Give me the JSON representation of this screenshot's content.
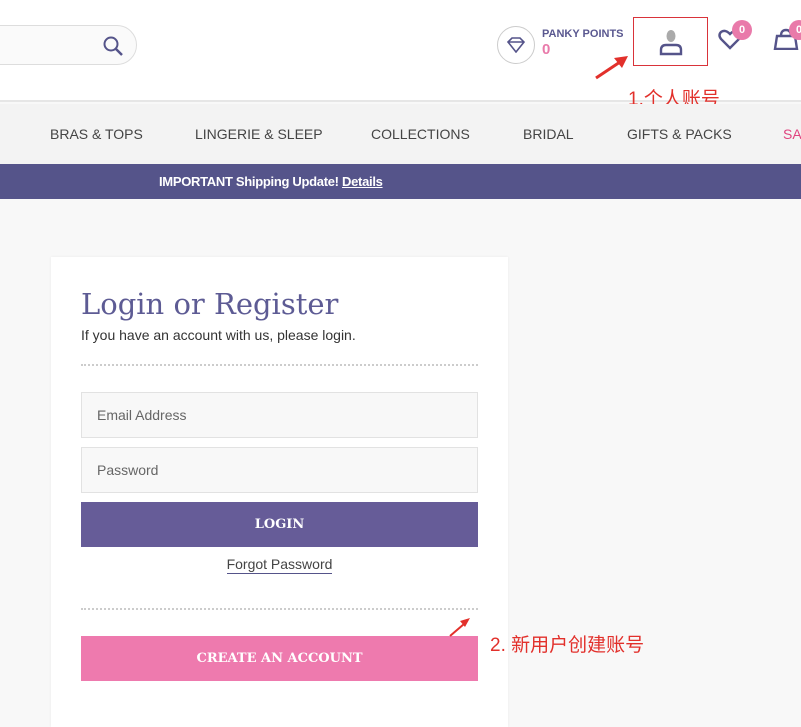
{
  "header": {
    "points_label": "PANKY POINTS",
    "points_value": "0",
    "wishlist_count": "0",
    "cart_count": "0"
  },
  "nav": {
    "items": [
      "BRAS & TOPS",
      "LINGERIE & SLEEP",
      "COLLECTIONS",
      "BRIDAL",
      "GIFTS & PACKS",
      "SA"
    ],
    "sale_color": "#e0447f"
  },
  "banner": {
    "text": "IMPORTANT Shipping Update!",
    "link": "Details"
  },
  "login": {
    "title": "Login or Register",
    "subtitle": "If you have an account with us, please login.",
    "email_placeholder": "Email Address",
    "password_placeholder": "Password",
    "login_button": "LOGIN",
    "forgot": "Forgot Password",
    "create_button": "CREATE AN ACCOUNT"
  },
  "annotations": {
    "account": "1.个人账号",
    "create": "2. 新用户创建账号"
  },
  "colors": {
    "primary": "#665c98",
    "pink": "#ee7aae",
    "annotation": "#e2302b"
  }
}
